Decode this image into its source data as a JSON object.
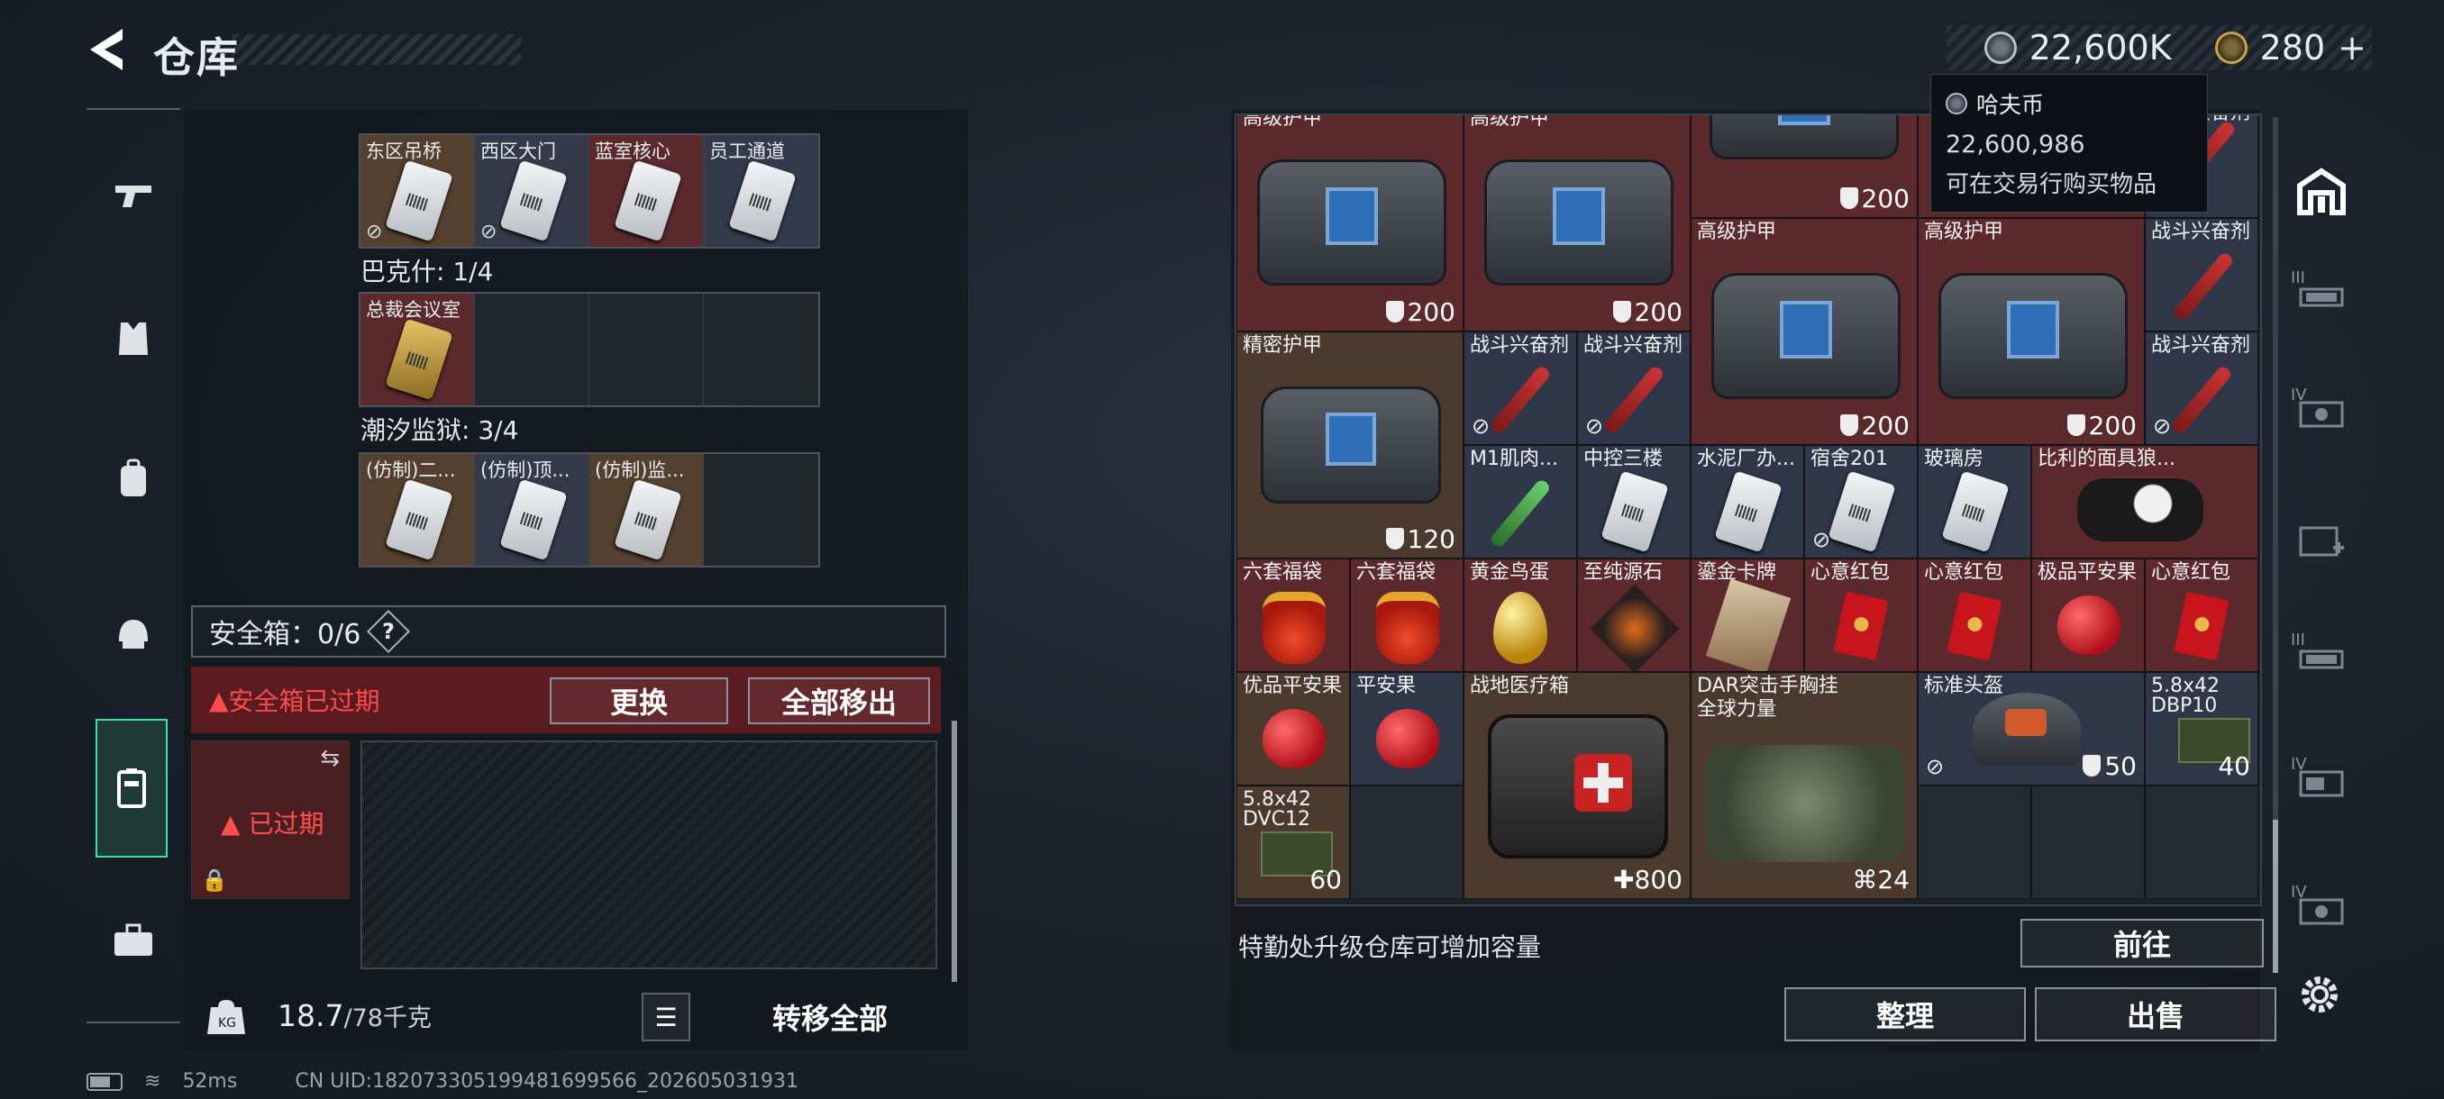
{
  "header": {
    "title": "仓库"
  },
  "currency": {
    "haf_value": "22,600K",
    "gold_value": "280"
  },
  "tooltip": {
    "name": "哈夫币",
    "amount": "22,600,986",
    "desc": "可在交易行购买物品"
  },
  "keys": {
    "row1_labels": [
      "东区吊桥",
      "西区大门",
      "蓝室核心",
      "员工通道"
    ],
    "section2_label": "巴克什: 1/4",
    "row2_labels": [
      "总裁会议室",
      "",
      "",
      ""
    ],
    "section3_label": "潮汐监狱: 3/4",
    "row3_labels": [
      "(仿制)二...",
      "(仿制)顶...",
      "(仿制)监...",
      ""
    ]
  },
  "safebox": {
    "label": "安全箱：0/6",
    "help": "?",
    "expired_warning": "安全箱已过期",
    "replace_button": "更换",
    "move_all_button": "全部移出",
    "slot_status": "已过期"
  },
  "backpack": {
    "weight": "18.7",
    "weight_max": "/78千克",
    "transfer_all_button": "转移全部"
  },
  "inventory": {
    "items": [
      {
        "name": "高级护甲",
        "value": "200"
      },
      {
        "name": "高级护甲",
        "value": "200"
      },
      {
        "name": "",
        "value": "200"
      },
      {
        "name": "高级护甲",
        "value": "200"
      },
      {
        "name": "高级护甲",
        "value": "200"
      },
      {
        "name": "战斗兴奋剂",
        "value": ""
      },
      {
        "name": "精密护甲",
        "value": "120"
      },
      {
        "name": "战斗兴奋剂",
        "value": ""
      },
      {
        "name": "战斗兴奋剂",
        "value": ""
      },
      {
        "name": "战斗兴奋剂",
        "value": ""
      },
      {
        "name": "M1肌肉...",
        "value": ""
      },
      {
        "name": "中控三楼",
        "value": ""
      },
      {
        "name": "水泥厂办...",
        "value": ""
      },
      {
        "name": "宿舍201",
        "value": ""
      },
      {
        "name": "玻璃房",
        "value": ""
      },
      {
        "name": "比利的面具狼...",
        "value": ""
      },
      {
        "name": "六套福袋",
        "value": ""
      },
      {
        "name": "六套福袋",
        "value": ""
      },
      {
        "name": "黄金鸟蛋",
        "value": ""
      },
      {
        "name": "至纯源石",
        "value": ""
      },
      {
        "name": "鎏金卡牌",
        "value": ""
      },
      {
        "name": "心意红包",
        "value": ""
      },
      {
        "name": "心意红包",
        "value": ""
      },
      {
        "name": "极品平安果",
        "value": ""
      },
      {
        "name": "心意红包",
        "value": ""
      },
      {
        "name": "优品平安果",
        "value": ""
      },
      {
        "name": "平安果",
        "value": ""
      },
      {
        "name": "战地医疗箱",
        "value": "800"
      },
      {
        "name": "DAR突击手胸挂",
        "name2": "全球力量",
        "value": "24"
      },
      {
        "name": "标准头盔",
        "value": "50"
      },
      {
        "name": "5.8x42",
        "name2": "DBP10",
        "value": "40"
      },
      {
        "name": "5.8x42",
        "name2": "DVC12",
        "value": "60"
      }
    ],
    "partial_top_right_name": "战斗兴奋剂"
  },
  "footer": {
    "hint": "特勤处升级仓库可增加容量",
    "goto_button": "前往",
    "sort_button": "整理",
    "sell_button": "出售"
  },
  "right_nav_tiers": [
    "III",
    "IV",
    "",
    "III",
    "IV",
    "IV"
  ],
  "status": {
    "ping": "52ms",
    "uid": "CN UID:182073305199481699566_202605031931"
  },
  "colors": {
    "accent": "#3ee0a6",
    "warning": "#ff4b4b",
    "armor_bg": "#5c2a2d"
  }
}
